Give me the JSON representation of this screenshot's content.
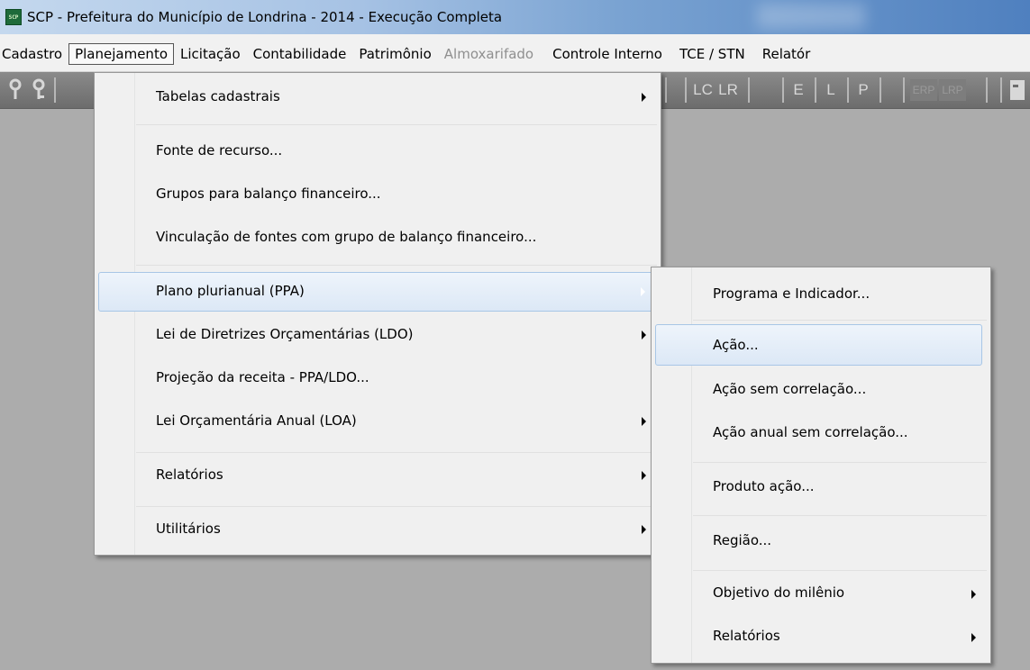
{
  "window": {
    "title": "SCP - Prefeitura do Município de Londrina - 2014 - Execução Completa",
    "icon_text": "SCP",
    "icon": "scp-app-icon"
  },
  "menubar": [
    {
      "label": "Cadastro",
      "state": "normal"
    },
    {
      "label": "Planejamento",
      "state": "open"
    },
    {
      "label": "Licitação",
      "state": "normal"
    },
    {
      "label": "Contabilidade",
      "state": "normal"
    },
    {
      "label": "Patrimônio",
      "state": "normal"
    },
    {
      "label": "Almoxarifado",
      "state": "disabled"
    },
    {
      "label": "Controle Interno",
      "state": "normal"
    },
    {
      "label": "TCE / STN",
      "state": "normal"
    },
    {
      "label": "Relatór",
      "state": "normal"
    }
  ],
  "toolbar": {
    "buttons": [
      "LC",
      "LR",
      "E",
      "L",
      "P",
      "ERP",
      "LRP"
    ],
    "icons": [
      "key-icon",
      "key-icon",
      "page-icon"
    ]
  },
  "planejamento_menu": {
    "items": [
      {
        "label": "Tabelas cadastrais",
        "submenu": true
      },
      {
        "label": "Fonte de recurso...",
        "submenu": false
      },
      {
        "label": "Grupos para balanço financeiro...",
        "submenu": false
      },
      {
        "label": "Vinculação de fontes com grupo de balanço financeiro...",
        "submenu": false
      },
      {
        "label": "Plano plurianual (PPA)",
        "submenu": true,
        "highlighted": true
      },
      {
        "label": "Lei de Diretrizes Orçamentárias (LDO)",
        "submenu": true
      },
      {
        "label": "Projeção da receita - PPA/LDO...",
        "submenu": false
      },
      {
        "label": "Lei Orçamentária Anual (LOA)",
        "submenu": true
      },
      {
        "label": "Relatórios",
        "submenu": true
      },
      {
        "label": "Utilitários",
        "submenu": true
      }
    ]
  },
  "ppa_submenu": {
    "items": [
      {
        "label": "Programa e Indicador...",
        "submenu": false
      },
      {
        "label": "Ação...",
        "submenu": false,
        "highlighted": true
      },
      {
        "label": "Ação sem correlação...",
        "submenu": false
      },
      {
        "label": "Ação anual sem correlação...",
        "submenu": false
      },
      {
        "label": "Produto ação...",
        "submenu": false
      },
      {
        "label": "Região...",
        "submenu": false
      },
      {
        "label": "Objetivo do milênio",
        "submenu": true
      },
      {
        "label": "Relatórios",
        "submenu": true
      }
    ]
  },
  "colors": {
    "menu_bg": "#f0f0f0",
    "highlight_border": "#a8c6e6",
    "workspace": "#acacac",
    "disabled_text": "#8f8f8f"
  }
}
